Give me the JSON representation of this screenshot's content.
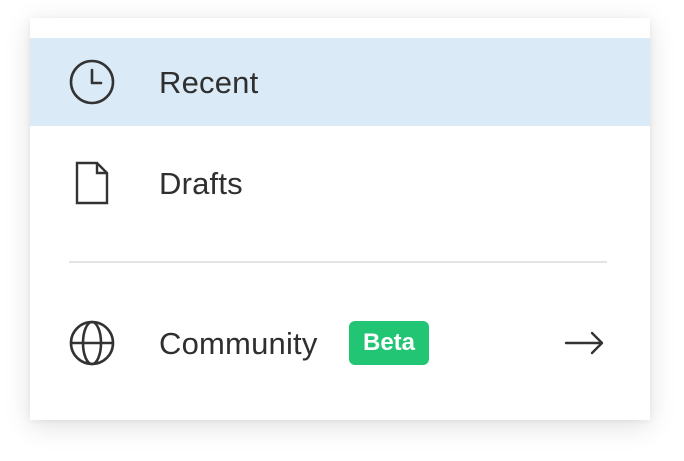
{
  "menu": {
    "items": [
      {
        "label": "Recent",
        "icon": "clock-icon",
        "selected": true
      },
      {
        "label": "Drafts",
        "icon": "document-icon",
        "selected": false
      },
      {
        "label": "Community",
        "icon": "globe-icon",
        "badge": "Beta",
        "trailing_icon": "arrow-right-icon",
        "selected": false
      }
    ]
  },
  "colors": {
    "selected_background": "#daeaf7",
    "badge_background": "#22c574",
    "text": "#2f2f2f",
    "icon_stroke": "#333333",
    "divider": "#e4e4e4"
  }
}
